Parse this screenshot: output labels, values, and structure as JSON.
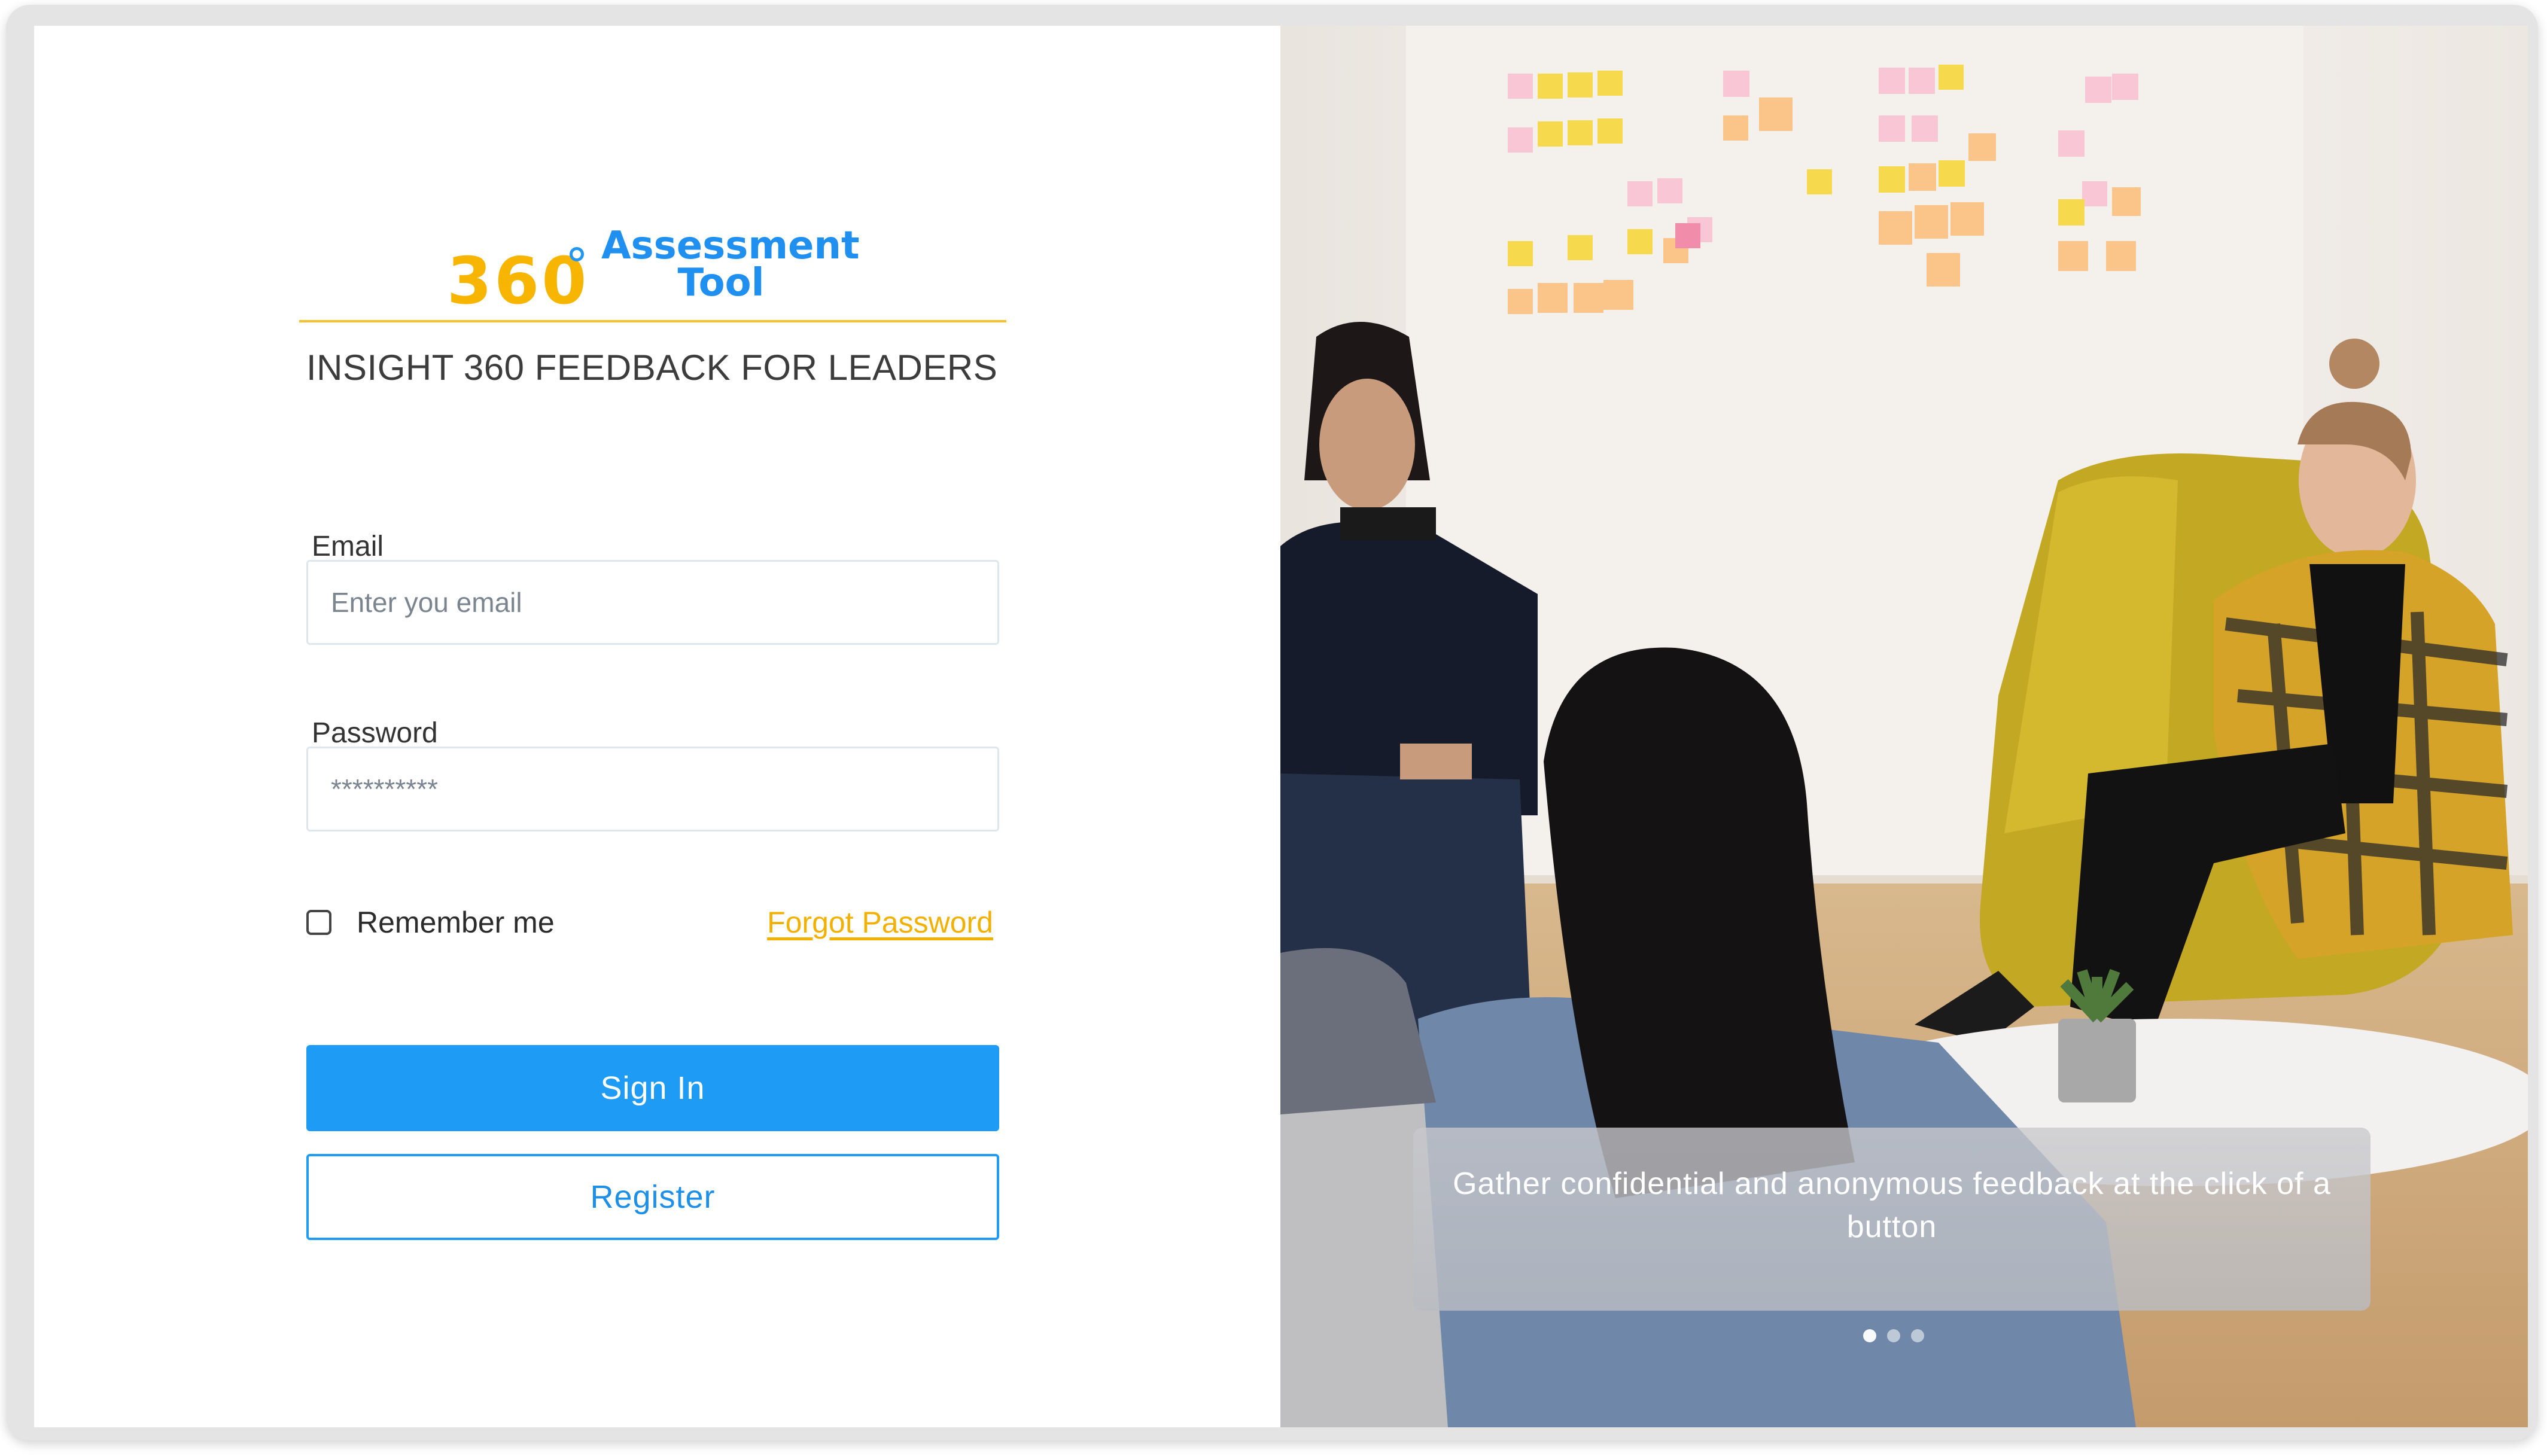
{
  "logo": {
    "number": "360",
    "line1": "Assessment",
    "line2": "Tool"
  },
  "subtitle": "INSIGHT 360 FEEDBACK FOR LEADERS",
  "email": {
    "label": "Email",
    "placeholder": "Enter you email"
  },
  "password": {
    "label": "Password",
    "placeholder": "**********"
  },
  "remember_label": "Remember me",
  "forgot_label": "Forgot Password",
  "sign_in_label": "Sign In",
  "register_label": "Register",
  "carousel": {
    "caption": "Gather confidential and anonymous feedback at the click of a button",
    "dots": 3,
    "active_dot": 1
  },
  "colors": {
    "primary": "#1e9bf5",
    "logo_yellow": "#f7b500",
    "logo_blue": "#1f8ff0",
    "link": "#f2b100",
    "divider": "#f5c12e"
  }
}
